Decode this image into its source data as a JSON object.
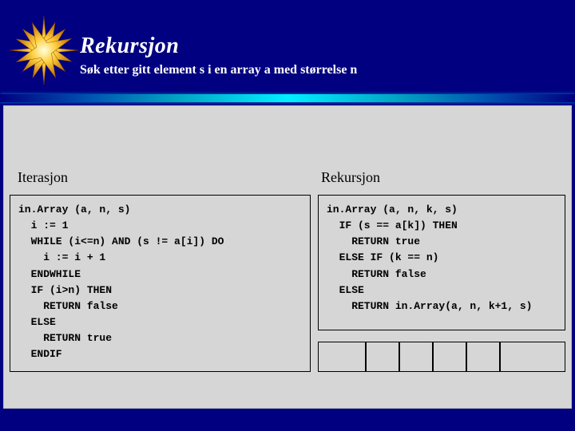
{
  "title": "Rekursjon",
  "subtitle": "Søk etter gitt element s i en array a med størrelse n",
  "labels": {
    "iteration": "Iterasjon",
    "recursion": "Rekursjon"
  },
  "code": {
    "iteration": "in.Array (a, n, s)\n  i := 1\n  WHILE (i<=n) AND (s != a[i]) DO\n    i := i + 1\n  ENDWHILE\n  IF (i>n) THEN\n    RETURN false\n  ELSE\n    RETURN true\n  ENDIF",
    "recursion": "in.Array (a, n, k, s)\n  IF (s == a[k]) THEN\n    RETURN true\n  ELSE IF (k == n)\n    RETURN false\n  ELSE\n    RETURN in.Array(a, n, k+1, s)"
  }
}
